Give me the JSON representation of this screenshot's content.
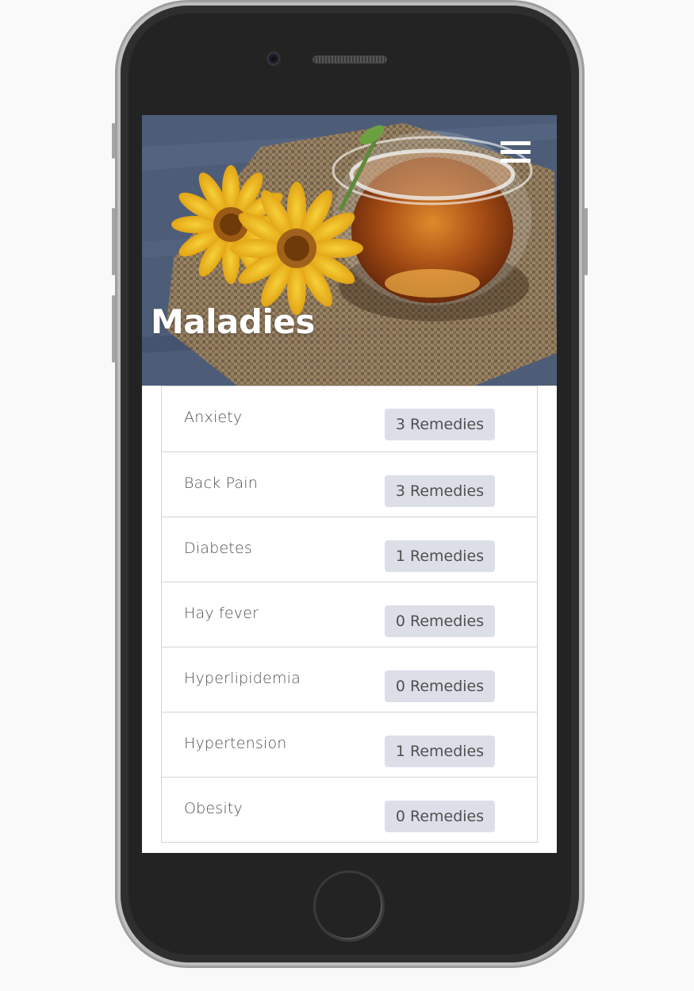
{
  "header": {
    "title": "Maladies",
    "menu_icon": "hamburger-menu-icon"
  },
  "maladies": [
    {
      "name": "Anxiety",
      "remedies": "3 Remedies"
    },
    {
      "name": "Back Pain",
      "remedies": "3 Remedies"
    },
    {
      "name": "Diabetes",
      "remedies": "1 Remedies"
    },
    {
      "name": "Hay fever",
      "remedies": "0 Remedies"
    },
    {
      "name": "Hyperlipidemia",
      "remedies": "0 Remedies"
    },
    {
      "name": "Hypertension",
      "remedies": "1 Remedies"
    },
    {
      "name": "Obesity",
      "remedies": "0 Remedies"
    }
  ],
  "colors": {
    "badge_bg": "#dcdfe8",
    "text": "#505050",
    "phone_body": "#232323"
  }
}
